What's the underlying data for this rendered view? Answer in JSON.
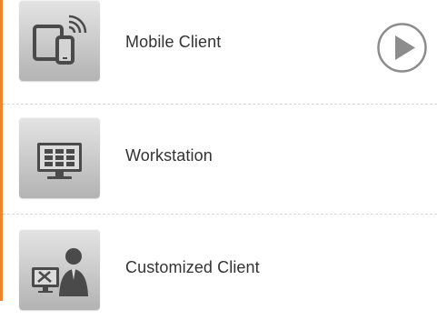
{
  "menu": {
    "items": [
      {
        "label": "Mobile Client",
        "icon": "mobile-devices-icon"
      },
      {
        "label": "Workstation",
        "icon": "workstation-monitor-icon"
      },
      {
        "label": "Customized Client",
        "icon": "customized-client-icon"
      }
    ],
    "action_icon": "play-icon"
  },
  "colors": {
    "accent": "#f0852b",
    "tile_dark": "#4a4a4a",
    "text": "#333333",
    "divider": "#d8d8d8",
    "play": "#8c8c8c"
  }
}
